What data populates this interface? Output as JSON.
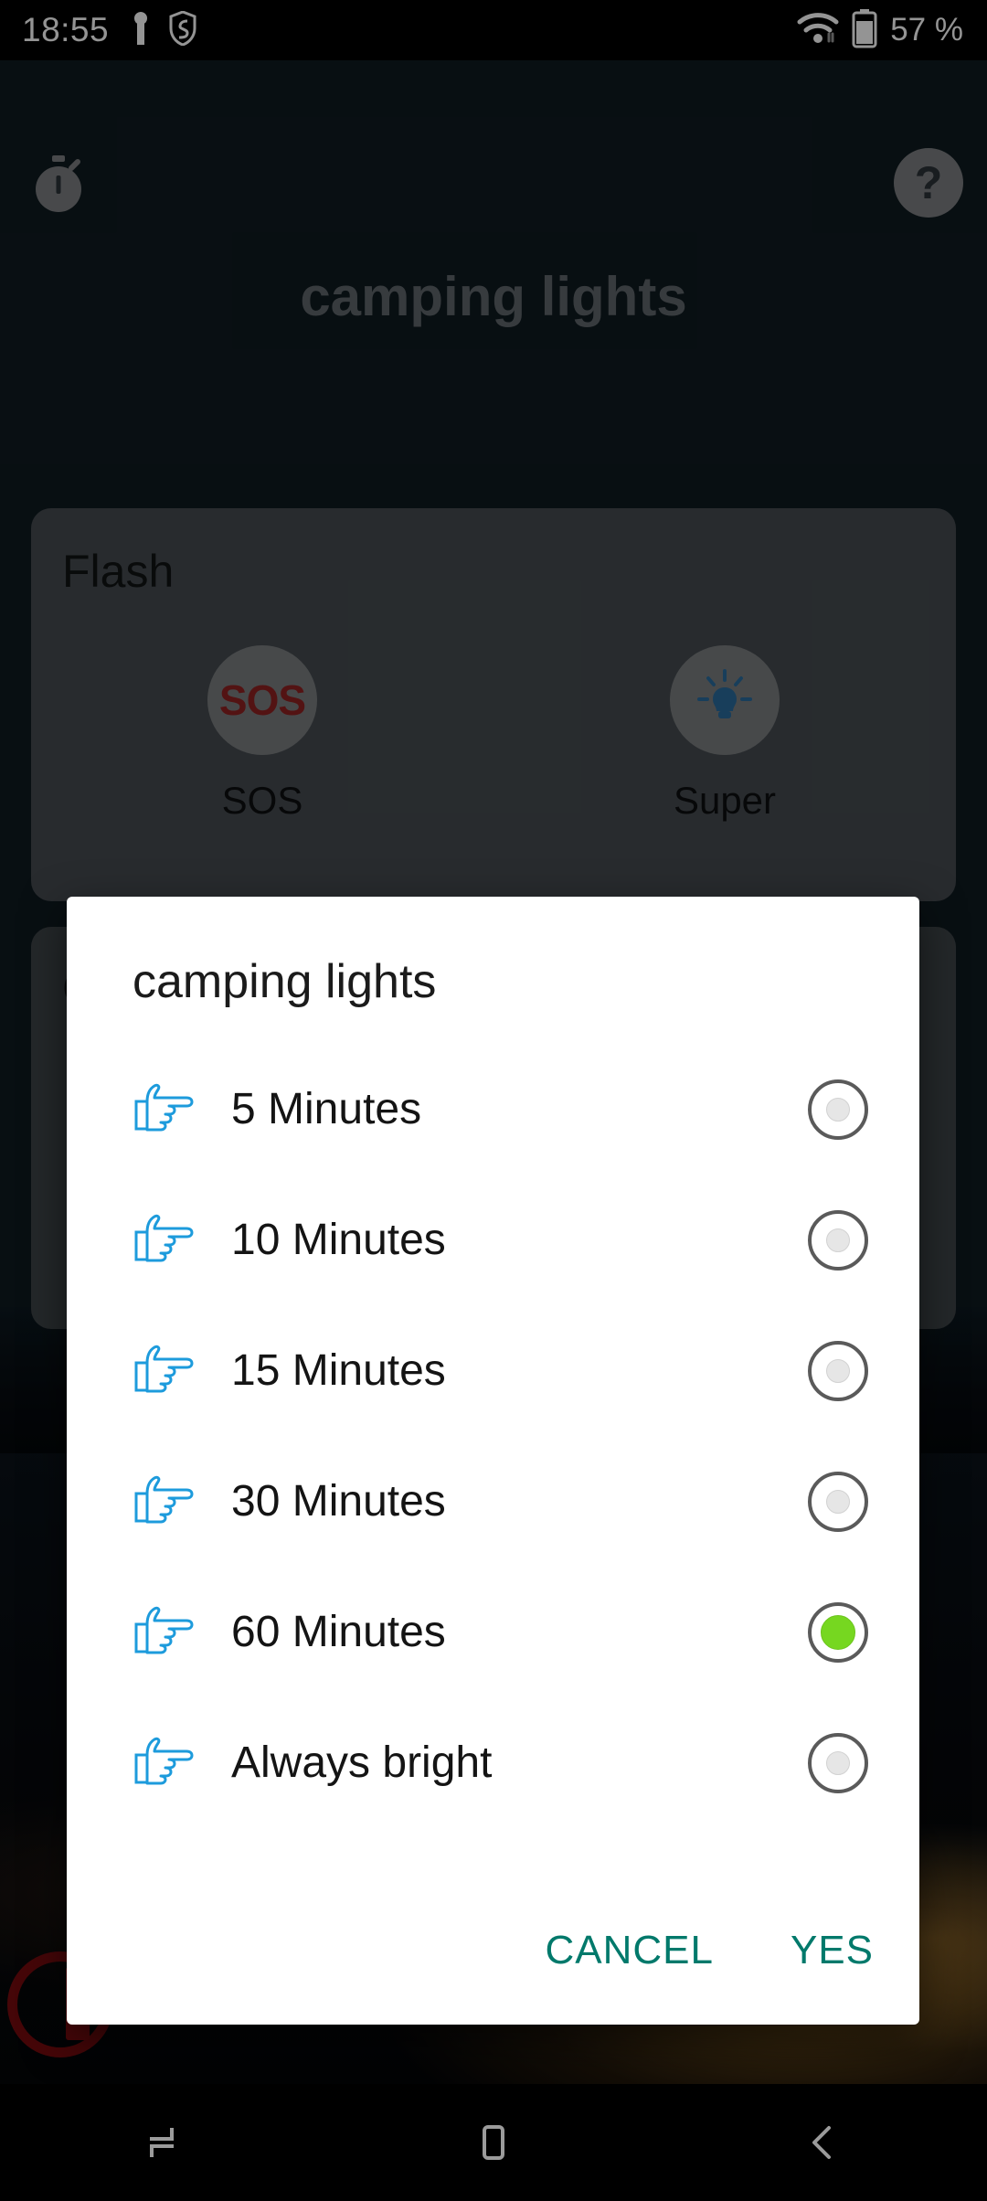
{
  "status_bar": {
    "time": "18:55",
    "left_icons": [
      "vpn-key-icon",
      "shield-icon"
    ],
    "wifi_icon": "wifi-icon",
    "battery_icon": "battery-icon",
    "battery_text": "57 %"
  },
  "toolbar": {
    "timer_icon": "timer-icon",
    "help_icon": "help-icon",
    "help_label": "?"
  },
  "app": {
    "title": "camping lights"
  },
  "cards": [
    {
      "title": "Flash",
      "items": [
        {
          "icon": "sos-icon",
          "glyph": "SOS",
          "label": "SOS"
        },
        {
          "icon": "bulb-icon",
          "glyph": "",
          "label": "Super"
        }
      ]
    },
    {
      "title": "C"
    }
  ],
  "dialog": {
    "title": "camping lights",
    "options": [
      {
        "icon": "pointing-hand-icon",
        "label": "5 Minutes",
        "selected": false
      },
      {
        "icon": "pointing-hand-icon",
        "label": "10 Minutes",
        "selected": false
      },
      {
        "icon": "pointing-hand-icon",
        "label": "15 Minutes",
        "selected": false
      },
      {
        "icon": "pointing-hand-icon",
        "label": "30 Minutes",
        "selected": false
      },
      {
        "icon": "pointing-hand-icon",
        "label": "60 Minutes",
        "selected": true
      },
      {
        "icon": "pointing-hand-icon",
        "label": "Always bright",
        "selected": false
      }
    ],
    "cancel_label": "CANCEL",
    "confirm_label": "YES"
  },
  "nav_bar": {
    "recents_icon": "recents-icon",
    "home_icon": "home-icon",
    "back_icon": "back-icon"
  },
  "colors": {
    "accent_teal": "#00796B",
    "selected_green": "#76D720",
    "hand_blue": "#1D9BDC",
    "sos_red": "#8F2222",
    "bulb_blue": "#2A6C9E",
    "background_dark": "#0F1A20",
    "card_grey": "#454B50"
  }
}
